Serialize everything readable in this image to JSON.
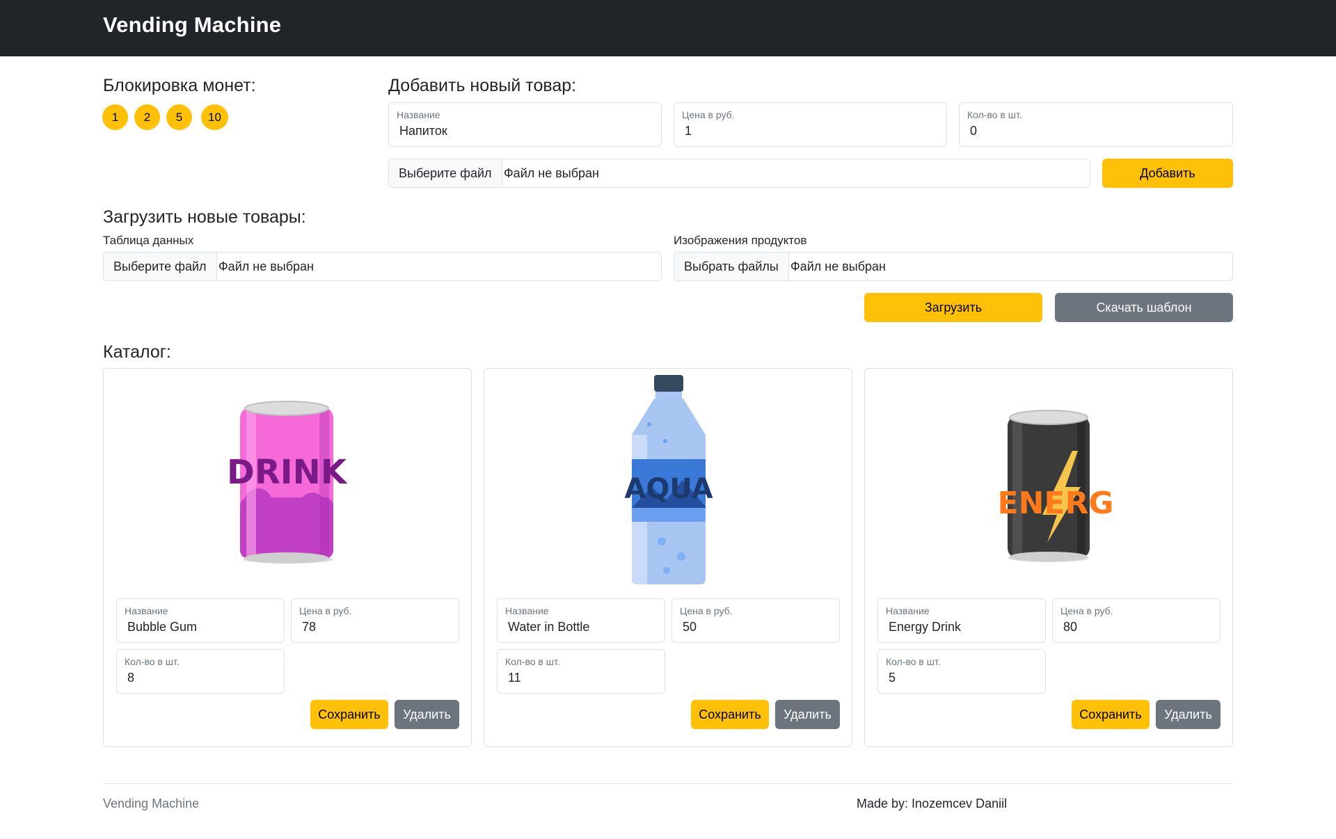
{
  "navbar": {
    "brand": "Vending Machine"
  },
  "coin_lock": {
    "title": "Блокировка монет:",
    "coins": [
      "1",
      "2",
      "5",
      "10"
    ],
    "coin_color": "#ffc107"
  },
  "add_product": {
    "title": "Добавить новый товар:",
    "name_label": "Название",
    "name_value": "Напиток",
    "price_label": "Цена в руб.",
    "price_value": "1",
    "qty_label": "Кол-во в шт.",
    "qty_value": "0",
    "file_button": "Выберите файл",
    "file_status": "Файл не выбран",
    "add_button": "Добавить"
  },
  "upload": {
    "title": "Загрузить новые товары:",
    "table_label": "Таблица данных",
    "table_file_button": "Выберите файл",
    "table_file_status": "Файл не выбран",
    "images_label": "Изображения продуктов",
    "images_file_button": "Выбрать файлы",
    "images_file_status": "Файл не выбран",
    "upload_button": "Загрузить",
    "template_button": "Скачать шаблон"
  },
  "catalog": {
    "title": "Каталог:",
    "field_labels": {
      "name": "Название",
      "price": "Цена в руб.",
      "qty": "Кол-во в шт."
    },
    "save_label": "Сохранить",
    "delete_label": "Удалить",
    "items": [
      {
        "name": "Bubble Gum",
        "price": "78",
        "qty": "8",
        "image_icon": "pink-drink-can-icon",
        "image_text": "DRINK"
      },
      {
        "name": "Water in Bottle",
        "price": "50",
        "qty": "11",
        "image_icon": "water-bottle-icon",
        "image_text": "AQUA"
      },
      {
        "name": "Energy Drink",
        "price": "80",
        "qty": "5",
        "image_icon": "energy-drink-can-icon",
        "image_text": "ENERG"
      }
    ]
  },
  "footer": {
    "left": "Vending Machine",
    "right": "Made by: Inozemcev Daniil"
  },
  "colors": {
    "navbar_bg": "#212529",
    "warning": "#ffc107",
    "secondary": "#6c757d",
    "border": "#dee2e6"
  }
}
